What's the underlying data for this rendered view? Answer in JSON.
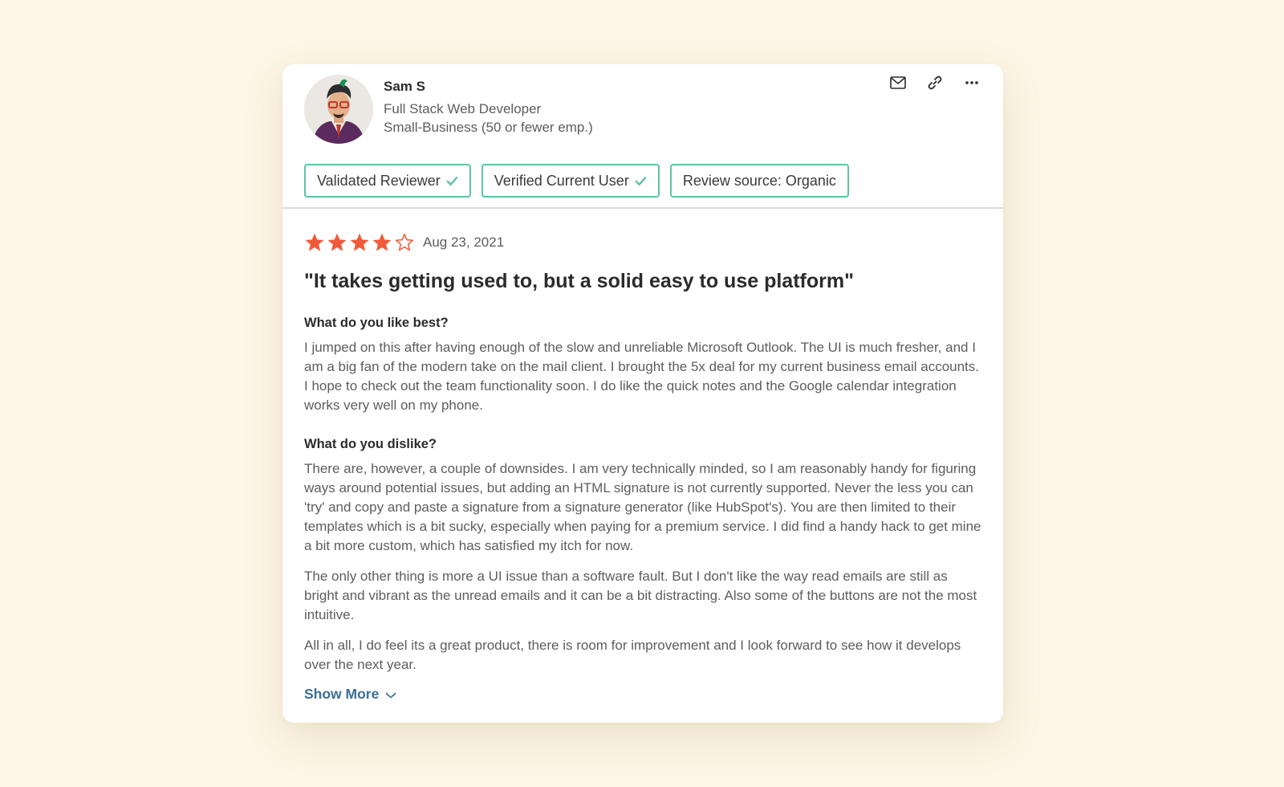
{
  "reviewer": {
    "name": "Sam S",
    "role": "Full Stack Web Developer",
    "segment": "Small-Business (50 or fewer emp.)"
  },
  "actions": [
    {
      "icon": "mail-icon"
    },
    {
      "icon": "link-icon"
    },
    {
      "icon": "more-icon"
    }
  ],
  "badges": [
    {
      "label": "Validated Reviewer",
      "checked": true
    },
    {
      "label": "Verified Current User",
      "checked": true
    },
    {
      "label": "Review source: Organic",
      "checked": false
    }
  ],
  "colors": {
    "accent_green": "#5fc3a6",
    "star_orange": "#f05a3a",
    "link_blue": "#3a6f96",
    "background": "#fdf6e6"
  },
  "review": {
    "rating": 4,
    "rating_max": 5,
    "date": "Aug 23, 2021",
    "title": "\"It takes getting used to, but a solid easy to use platform\"",
    "likes_question": "What do you like best?",
    "likes_answer": "I jumped on this after having enough of the slow and unreliable Microsoft Outlook. The UI is much fresher, and I am a big fan of the modern take on the mail client. I brought the 5x deal for my current business email accounts. I hope to check out the team functionality soon. I do like the quick notes and the Google calendar integration works very well on my phone.",
    "dislikes_question": "What do you dislike?",
    "dislikes_answer": [
      "There are, however, a couple of downsides. I am very technically minded, so I am reasonably handy for figuring ways around potential issues, but adding an HTML signature is not currently supported. Never the less you can 'try' and copy and paste a signature from a signature generator (like HubSpot's). You are then limited to their templates which is a bit sucky, especially when paying for a premium service. I did find a handy hack to get mine a bit more custom, which has satisfied my itch for now.",
      "The only other thing is more a UI issue than a software fault. But I don't like the way read emails are still as bright and vibrant as the unread emails and it can be a bit distracting. Also some of the buttons are not the most intuitive.",
      "All in all, I do feel its a great product, there is room for improvement and I look forward to see how it develops over the next year."
    ],
    "show_more_label": "Show More"
  }
}
